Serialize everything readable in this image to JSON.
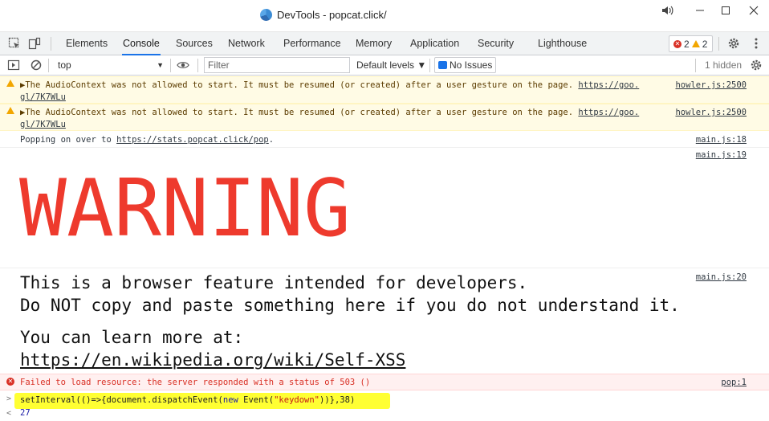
{
  "window": {
    "title": "DevTools - popcat.click/"
  },
  "tabs": [
    "Elements",
    "Console",
    "Sources",
    "Network",
    "Performance",
    "Memory",
    "Application",
    "Security",
    "Lighthouse"
  ],
  "active_tab": "Console",
  "badges": {
    "errors": "2",
    "warnings": "2"
  },
  "console_toolbar": {
    "context": "top",
    "filter_placeholder": "Filter",
    "levels": "Default levels ▼",
    "issues": "No Issues",
    "hidden": "1 hidden"
  },
  "messages": {
    "warn1": {
      "text": "▶The AudioContext was not allowed to start. It must be resumed (or created) after a user gesture on the page. ",
      "link": "https://goo.gl/7K7WLu",
      "link_a": "https://goo.",
      "link_b": "gl/7K7WLu",
      "source": "howler.js:2500"
    },
    "warn2": {
      "text": "▶The AudioContext was not allowed to start. It must be resumed (or created) after a user gesture on the page. ",
      "link_a": "https://goo.",
      "link_b": "gl/7K7WLu",
      "source": "howler.js:2500"
    },
    "log1": {
      "text": "Popping on over to ",
      "link": "https://stats.popcat.click/pop",
      "suffix": ".",
      "source": "main.js:18"
    },
    "log2": {
      "big": "WARNING",
      "source": "main.js:19"
    },
    "log3": {
      "line1": "This is a browser feature intended for developers.",
      "line2": "Do NOT copy and paste something here if you do not understand it.",
      "line3": "You can learn more at:",
      "link": "https://en.wikipedia.org/wiki/Self-XSS",
      "source": "main.js:20"
    },
    "error1": {
      "text": "Failed to load resource: the server responded with a status of 503 ()",
      "source": "pop:1"
    }
  },
  "input": {
    "prompt": ">",
    "code_a": "setInterval(()=>{document.dispatchEvent(",
    "code_new": "new",
    "code_b": " Event(",
    "code_str": "\"keydown\"",
    "code_c": "))},38)",
    "result_prompt": "<",
    "result": "27"
  }
}
